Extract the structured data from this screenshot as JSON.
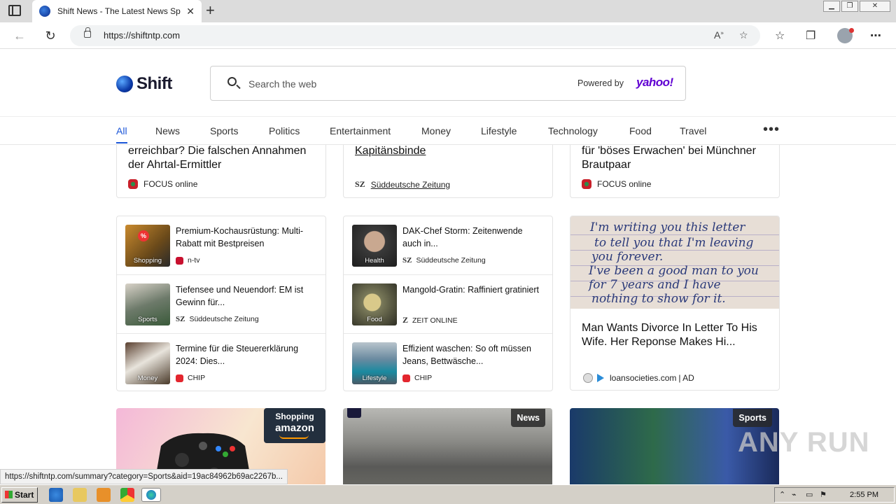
{
  "browser": {
    "tab_title": "Shift News - The Latest News Spo",
    "url": "https://shiftntp.com",
    "read_aloud_icon": "read-aloud-icon",
    "favorites_icon": "add-favorite-icon"
  },
  "header": {
    "logo_text": "Shift",
    "search_placeholder": "Search the web",
    "powered_by": "Powered by",
    "provider": "yahoo!"
  },
  "nav": {
    "items": [
      "All",
      "News",
      "Sports",
      "Politics",
      "Entertainment",
      "Money",
      "Lifestyle",
      "Technology",
      "Food",
      "Travel"
    ],
    "more": "•••"
  },
  "top_cards": [
    {
      "title": "erreichbar? Die falschen Annahmen der Ahrtal-Ermittler",
      "source": "FOCUS online"
    },
    {
      "title": "Kapitänsbinde",
      "source": "Süddeutsche Zeitung"
    },
    {
      "title": "für 'böses Erwachen' bei Münchner Brautpaar",
      "source": "FOCUS online"
    }
  ],
  "list_left": [
    {
      "category": "Shopping",
      "title": "Premium-Kochausrüstung: Multi-Rabatt mit Bestpreisen",
      "source": "n-tv"
    },
    {
      "category": "Sports",
      "title": "Tiefensee und Neuendorf: EM ist Gewinn für...",
      "source": "Süddeutsche Zeitung"
    },
    {
      "category": "Money",
      "title": "Termine für die Steuererklärung 2024: Dies...",
      "source": "CHIP"
    }
  ],
  "list_middle": [
    {
      "category": "Health",
      "title": "DAK-Chef Storm: Zeitenwende auch in...",
      "source": "Süddeutsche Zeitung"
    },
    {
      "category": "Food",
      "title": "Mangold-Gratin: Raffiniert gratiniert",
      "source": "ZEIT ONLINE"
    },
    {
      "category": "Lifestyle",
      "title": "Effizient waschen: So oft müssen Jeans, Bettwäsche...",
      "source": "CHIP"
    }
  ],
  "ad": {
    "handwriting": [
      "I'm writing you this letter",
      "to tell you that I'm leaving",
      "you forever.",
      "I've been a good man to you",
      "for 7 years and I have",
      "nothing to show for it."
    ],
    "title": "Man Wants Divorce In Letter To His Wife. Her Reponse Makes Hi...",
    "source": "loansocieties.com",
    "ad_label": "| AD"
  },
  "bottom_cards": [
    {
      "badge": "Shopping",
      "brand": "amazon"
    },
    {
      "badge": "News"
    },
    {
      "badge": "Sports"
    }
  ],
  "status_url": "https://shiftntp.com/summary?category=Sports&aid=19ac84962b69ac2267b...",
  "watermark": "ANY RUN",
  "taskbar": {
    "start": "Start",
    "time": "2:55 PM"
  }
}
